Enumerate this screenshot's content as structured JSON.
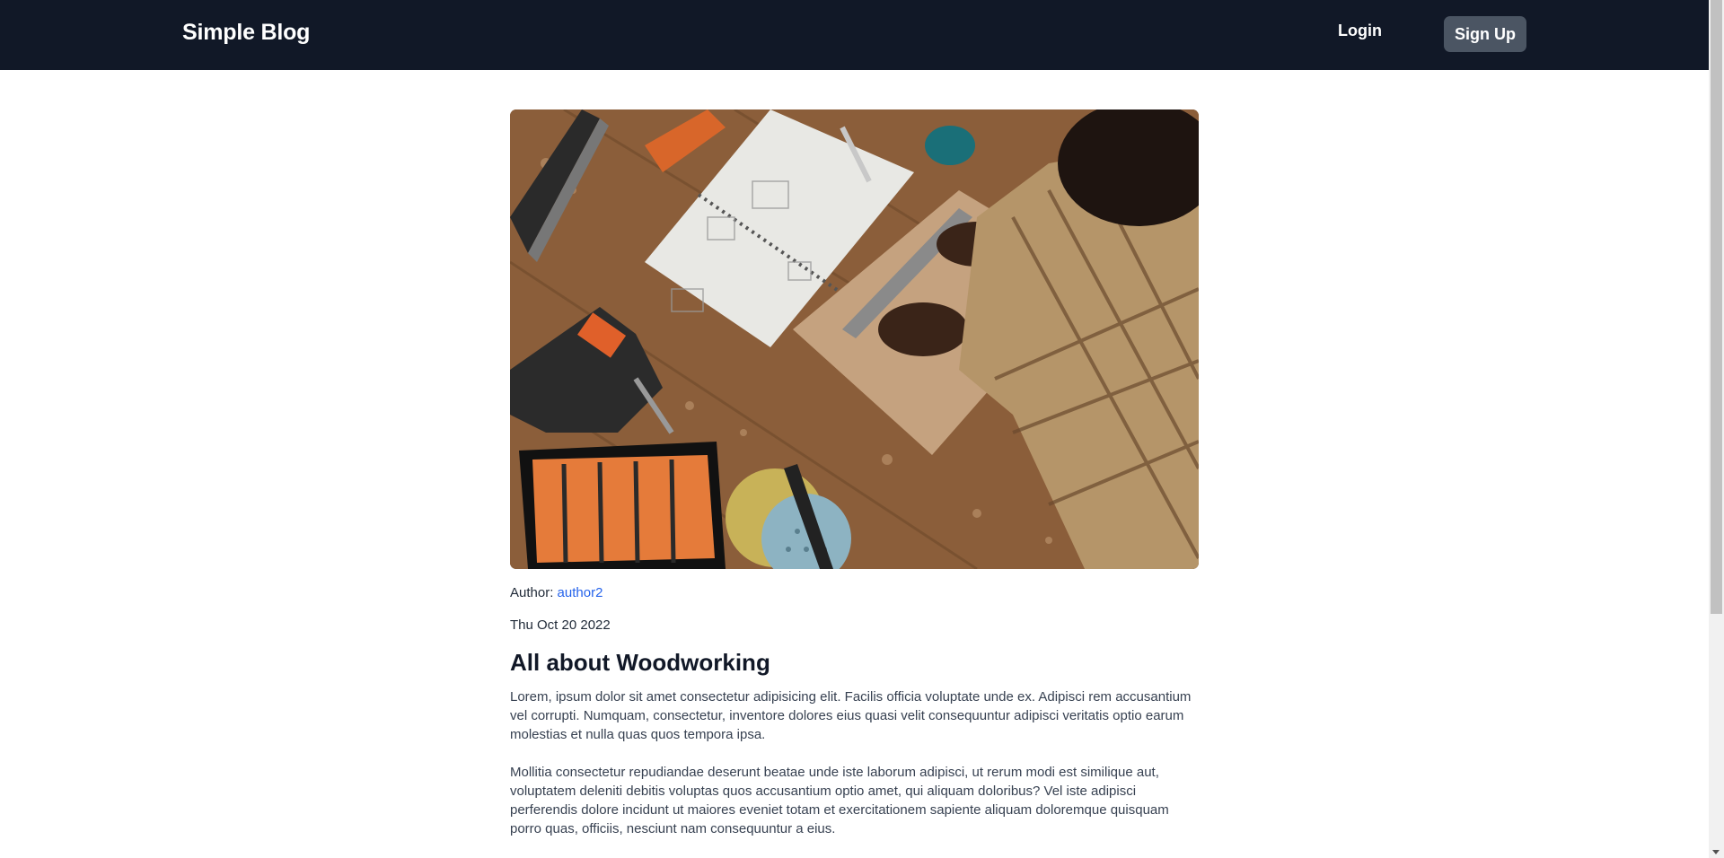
{
  "header": {
    "brand": "Simple Blog",
    "login_label": "Login",
    "signup_label": "Sign Up"
  },
  "post": {
    "author_prefix": "Author: ",
    "author_name": "author2",
    "date": "Thu Oct 20 2022",
    "title": "All about Woodworking",
    "paragraphs": [
      "Lorem, ipsum dolor sit amet consectetur adipisicing elit. Facilis officia voluptate unde ex. Adipisci rem accusantium vel corrupti. Numquam, consectetur, inventore dolores eius quasi velit consequuntur adipisci veritatis optio earum molestias et nulla quas quos tempora ipsa.",
      "Mollitia consectetur repudiandae deserunt beatae unde iste laborum adipisci, ut rerum modi est similique aut, voluptatem deleniti debitis voluptas quos accusantium optio amet, qui aliquam doloribus? Vel iste adipisci perferendis dolore incidunt ut maiores eveniet totam et exercitationem sapiente aliquam doloremque quisquam porro quas, officiis, nesciunt nam consequuntur a eius."
    ]
  },
  "colors": {
    "header_bg": "#111827",
    "signup_bg": "#4b5563",
    "link": "#2563eb"
  }
}
